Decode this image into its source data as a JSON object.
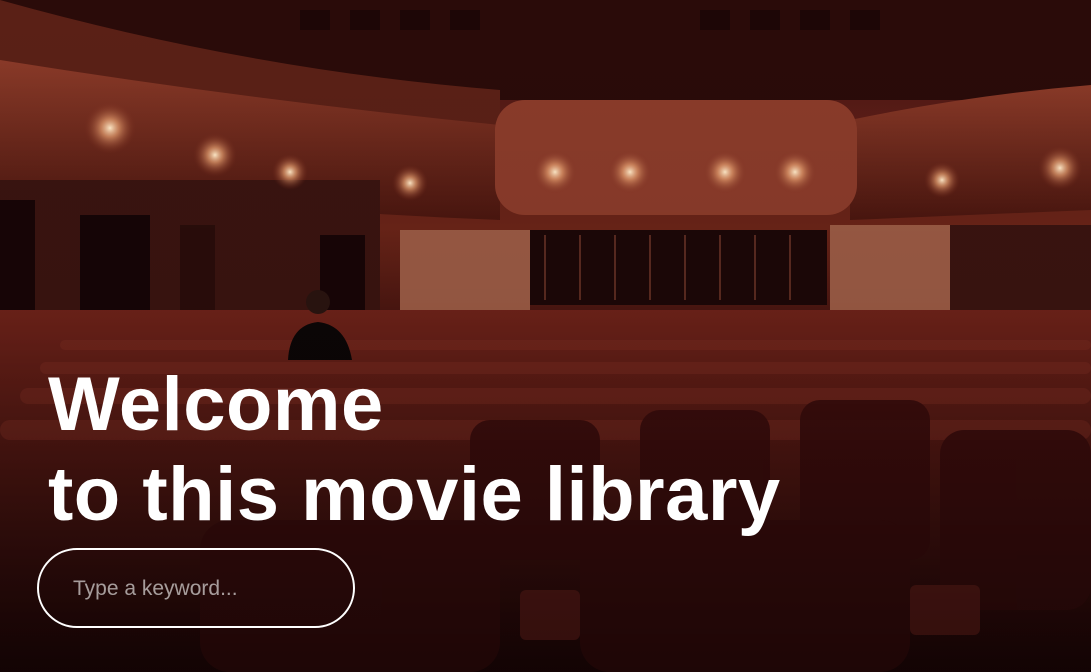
{
  "hero": {
    "title_line1": "Welcome",
    "title_line2": "to this movie library",
    "background": "theater-interior-photo"
  },
  "search": {
    "placeholder": "Type a keyword...",
    "value": ""
  },
  "colors": {
    "text": "#ffffff",
    "border": "#ffffff",
    "theme": "#5a1c16"
  }
}
